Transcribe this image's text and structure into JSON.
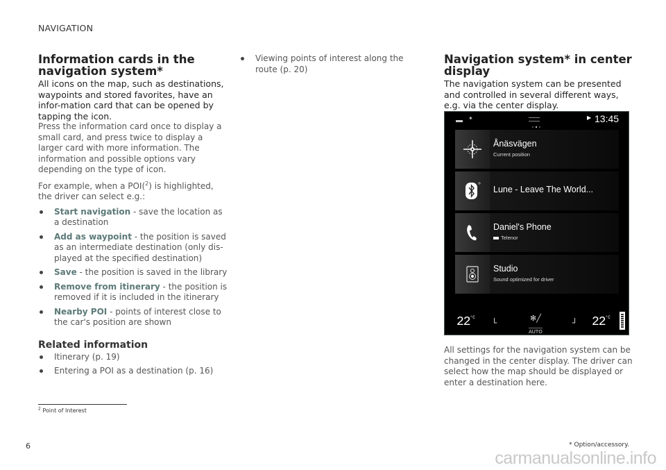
{
  "running_head": "NAVIGATION",
  "left_column": {
    "heading": "Information cards in the navigation system*",
    "lead": "All icons on the map, such as destinations, waypoints and stored favorites, have an infor-mation card that can be opened by tapping the icon.",
    "para1": "Press the information card once to display a small card, and press twice to display a larger card with more information. The information and possible options vary depending on the type of icon.",
    "para2_before": "For example, when a POI(",
    "para2_sup": "2",
    "para2_after": ") is highlighted, the driver can select e.g.:",
    "options": [
      {
        "term": "Start navigation",
        "desc": " - save the location as a destination"
      },
      {
        "term": "Add as waypoint",
        "desc": " - the position is saved as an intermediate destination (only dis-played at the specified destination)"
      },
      {
        "term": "Save",
        "desc": " - the position is saved in the library"
      },
      {
        "term": "Remove from itinerary",
        "desc": " - the position is removed if it is included in the itinerary"
      },
      {
        "term": "Nearby POI",
        "desc": " - points of interest close to the car's position are shown"
      }
    ],
    "related_heading": "Related information",
    "related": [
      "Itinerary (p. 19)",
      "Entering a POI as a destination (p. 16)"
    ]
  },
  "middle_column": {
    "related": [
      "Viewing points of interest along the route (p. 20)"
    ]
  },
  "right_column": {
    "heading": "Navigation system* in center display",
    "lead": "The navigation system can be presented and controlled in several different ways, e.g. via the center display.",
    "body": "All settings for the navigation system can be changed in the center display. The driver can select how the map should be displayed or enter a destination here."
  },
  "screen": {
    "clock": "13:45",
    "cards": [
      {
        "icon": "compass-icon",
        "title": "Ånäsvägen",
        "subtitle": "Current position"
      },
      {
        "icon": "bluetooth-icon",
        "title": "Lune - Leave The World...",
        "subtitle": ""
      },
      {
        "icon": "phone-icon",
        "title": "Daniel's Phone",
        "subtitle": "Telenor"
      },
      {
        "icon": "speaker-icon",
        "title": "Studio",
        "subtitle": "Sound optimized for driver"
      }
    ],
    "climate": {
      "left_temp": "22",
      "right_temp": "22",
      "unit": "°C",
      "mode": "AUTO"
    }
  },
  "footnote": {
    "number": "2",
    "text": "Point of Interest"
  },
  "page_number": "6",
  "option_note": "* Option/accessory.",
  "watermark": "carmanualsonline.info"
}
